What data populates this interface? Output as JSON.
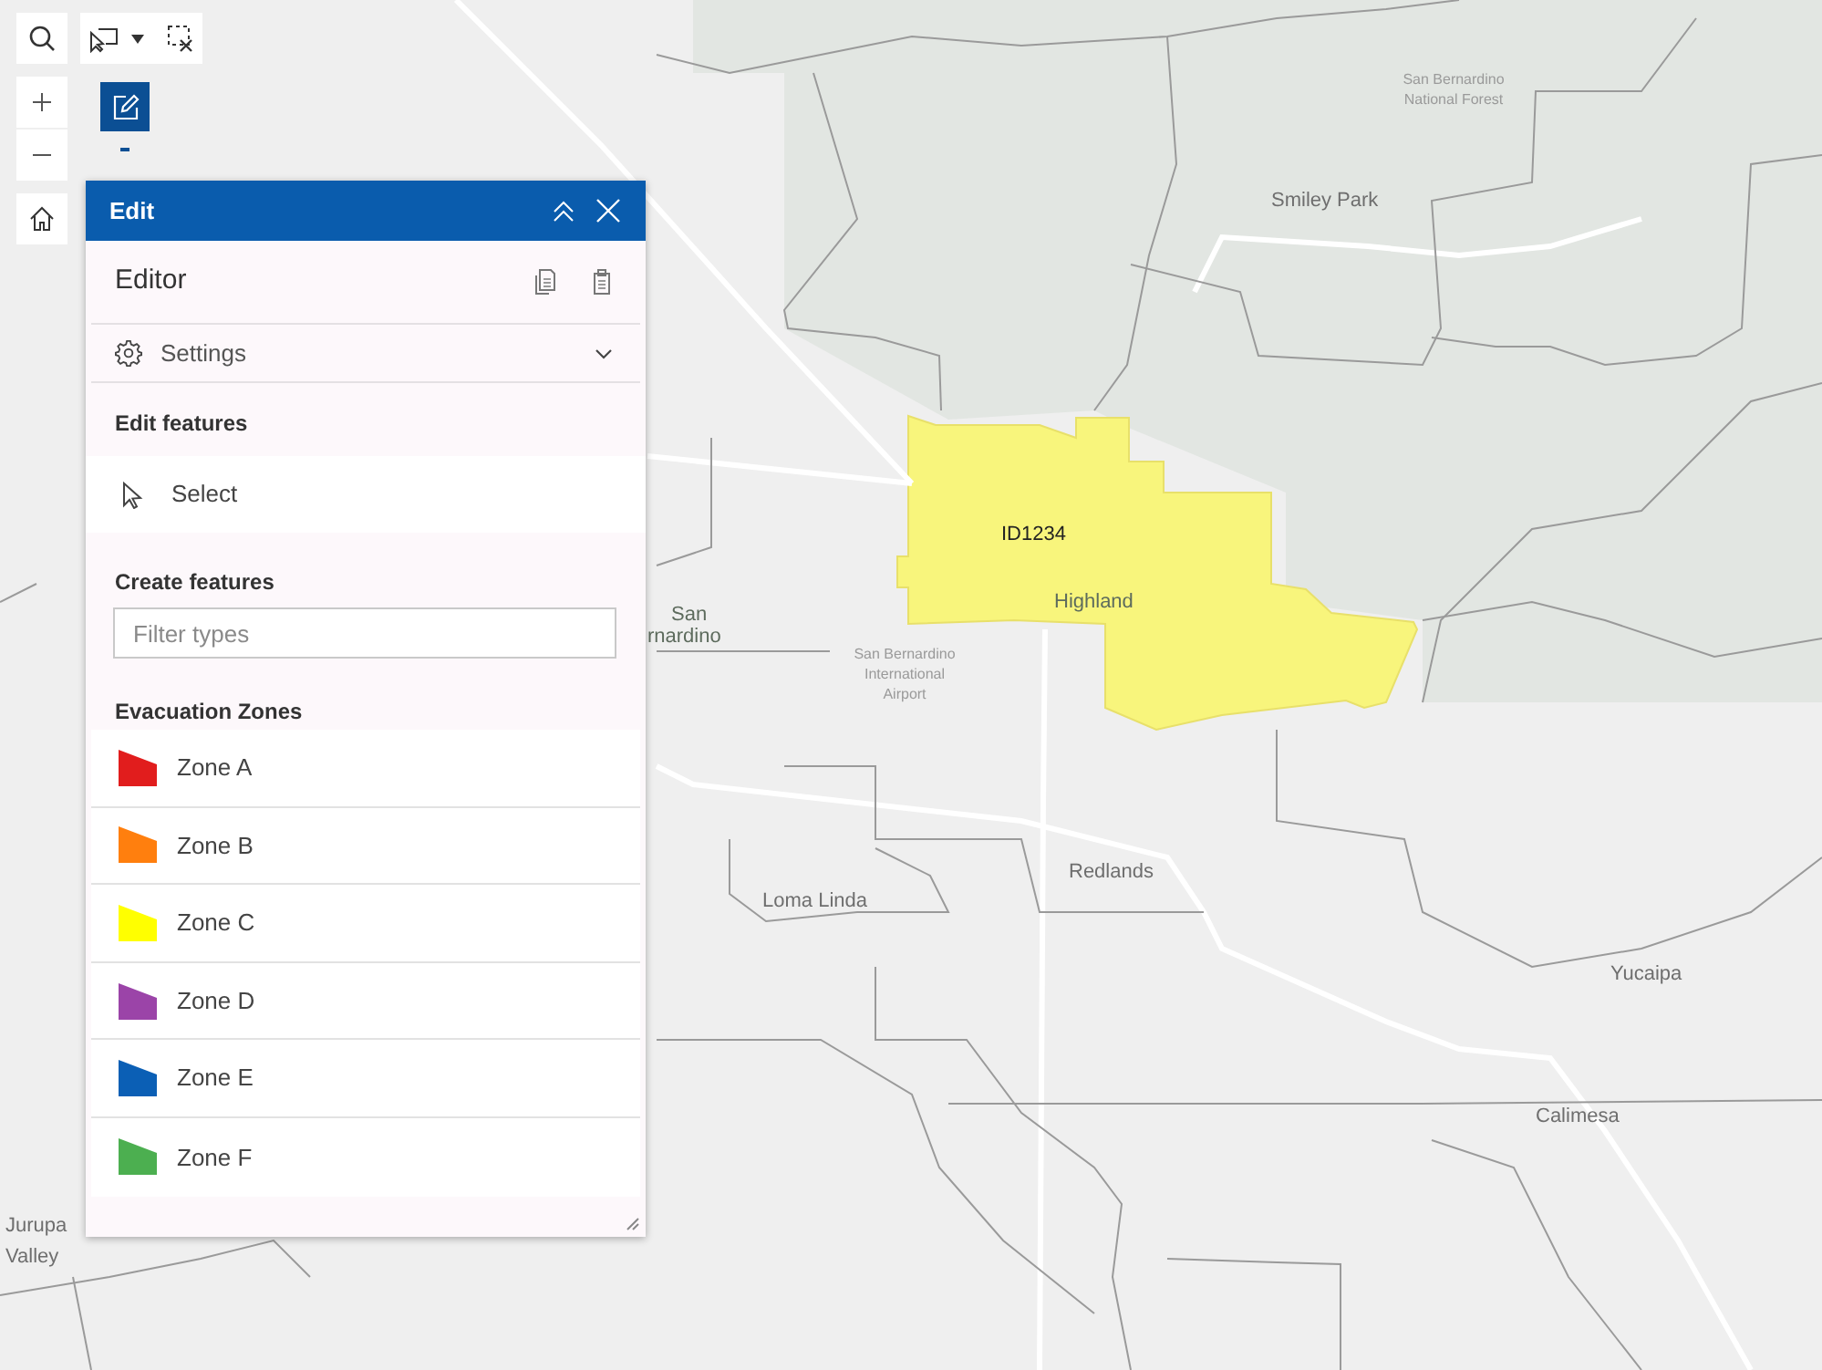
{
  "map": {
    "labels": [
      {
        "text": "San Bernardino National Forest",
        "kind": "region"
      },
      {
        "text": "Smiley Park",
        "kind": "place"
      },
      {
        "text": "ID1234",
        "kind": "feature"
      },
      {
        "text": "Highland",
        "kind": "city"
      },
      {
        "text": "San",
        "kind": "city"
      },
      {
        "text": "rnardino",
        "kind": "city"
      },
      {
        "text": "San Bernardino International Airport",
        "kind": "region"
      },
      {
        "text": "Loma Linda",
        "kind": "place"
      },
      {
        "text": "Redlands",
        "kind": "place"
      },
      {
        "text": "Yucaipa",
        "kind": "place"
      },
      {
        "text": "Calimesa",
        "kind": "place"
      },
      {
        "text": "Jurupa Valley",
        "kind": "place"
      }
    ]
  },
  "edit_button": {
    "selected": true
  },
  "panel": {
    "title": "Edit",
    "heading": "Editor",
    "settings": {
      "label": "Settings",
      "expanded": false
    },
    "edit_section": {
      "title": "Edit features",
      "tools": [
        {
          "label": "Select"
        }
      ]
    },
    "create_section": {
      "title": "Create features",
      "filter": {
        "placeholder": "Filter types"
      },
      "layer": "Evacuation Zones",
      "types": [
        {
          "label": "Zone A",
          "color": "#e11d1d"
        },
        {
          "label": "Zone B",
          "color": "#ff7f0e"
        },
        {
          "label": "Zone C",
          "color": "#ffff00"
        },
        {
          "label": "Zone D",
          "color": "#9b44a8"
        },
        {
          "label": "Zone E",
          "color": "#0b5fb5"
        },
        {
          "label": "Zone F",
          "color": "#4caf50"
        }
      ]
    }
  }
}
